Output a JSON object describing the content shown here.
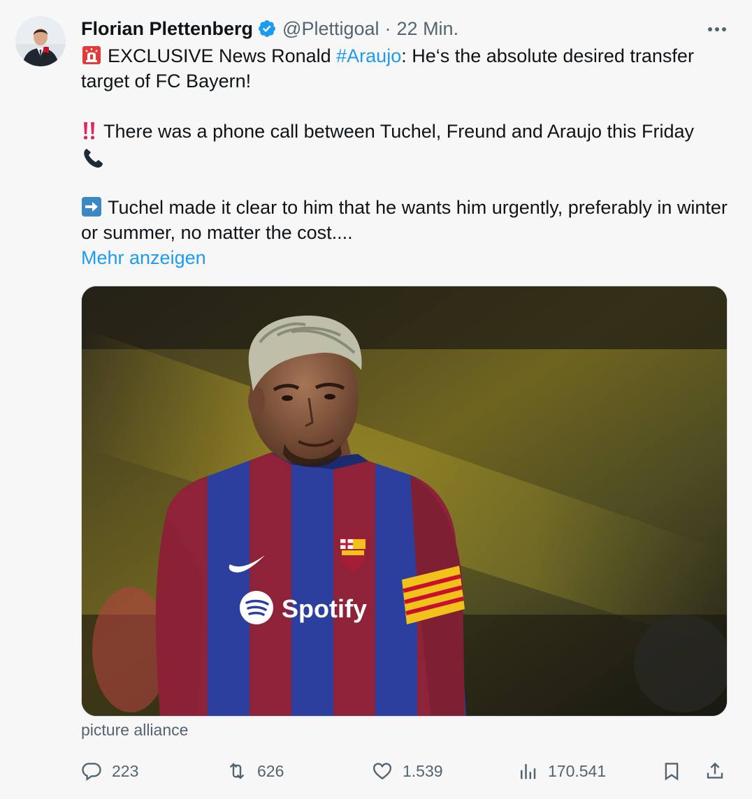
{
  "author": {
    "name": "Florian Plettenberg",
    "handle": "@Plettigoal",
    "separator": "·",
    "time": "22 Min.",
    "verified": true
  },
  "tweet": {
    "line1_emoji": "siren-icon",
    "line1_pre": "EXCLUSIVE News Ronald ",
    "line1_hashtag": "#Araujo",
    "line1_post": ": He‘s the absolute desired transfer target of FC Bayern!",
    "line2_emoji": "double-exclamation-icon",
    "line2_text": "There was a phone call between Tuchel, Freund and Araujo this Friday",
    "line2_trailing_emoji": "phone-receiver-icon",
    "line3_emoji": "right-arrow-icon",
    "line3_text": "Tuchel made it clear to him that he wants him urgently, preferably in winter or summer, no matter the cost....",
    "show_more": "Mehr anzeigen"
  },
  "media": {
    "caption": "picture alliance",
    "jersey_sponsor": "Spotify"
  },
  "actions": {
    "replies": "223",
    "reposts": "626",
    "likes": "1.539",
    "views": "170.541"
  },
  "colors": {
    "accent": "#1d9bf0",
    "secondary_text": "#536471",
    "background": "#f7f7f7",
    "jersey_blue": "#2c3f9e",
    "jersey_red": "#8e2238"
  }
}
